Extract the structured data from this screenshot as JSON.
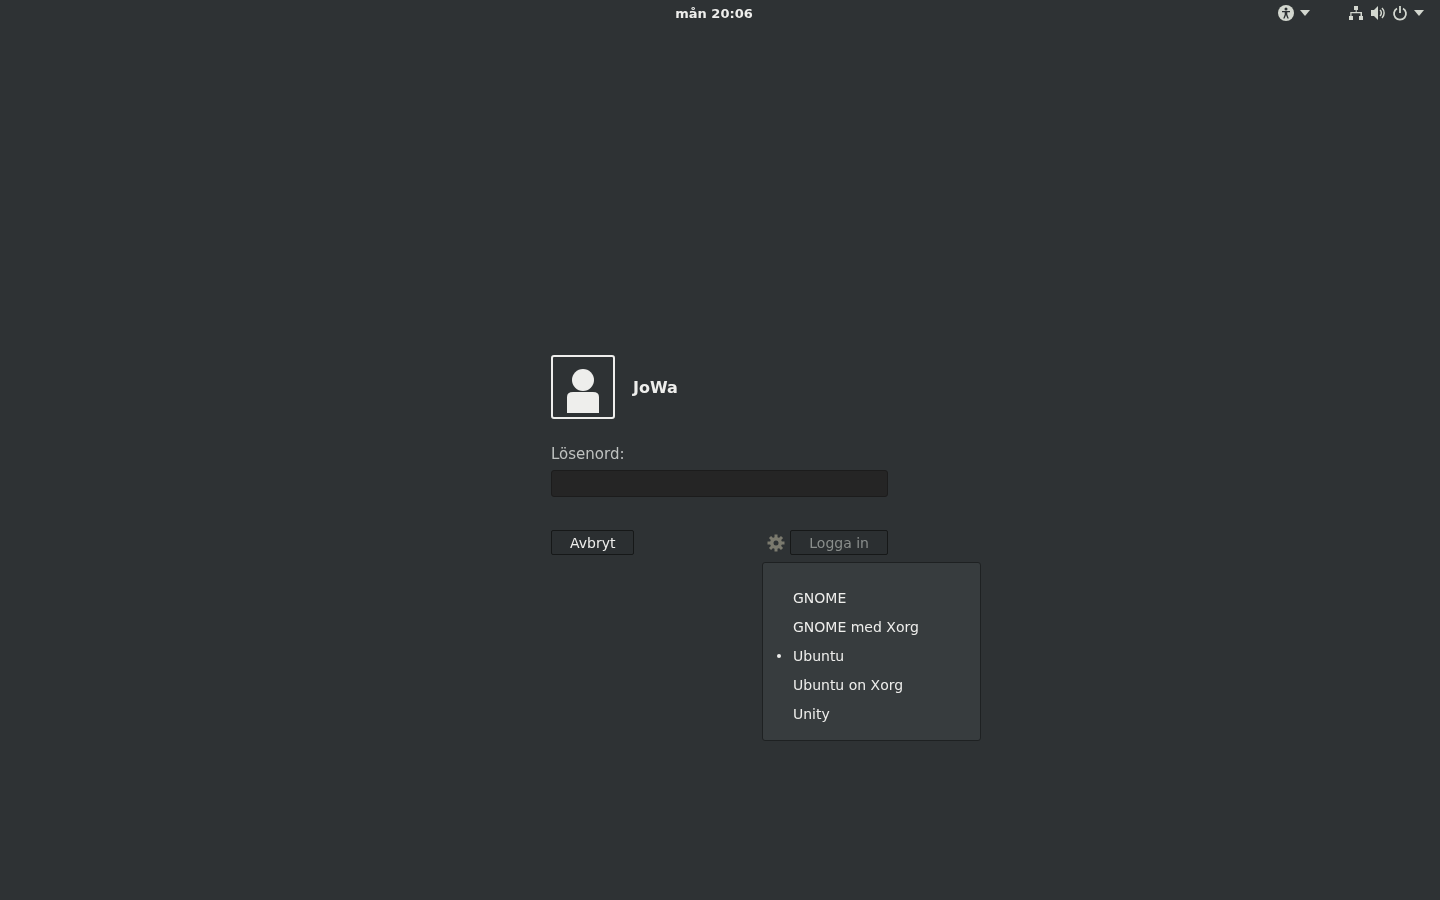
{
  "top_bar": {
    "clock": "mån 20:06"
  },
  "user": {
    "name": "JoWa"
  },
  "password": {
    "label": "Lösenord:"
  },
  "buttons": {
    "cancel": {
      "label": "Avbryt",
      "disabled": false
    },
    "login": {
      "label": "Logga in",
      "disabled": true
    }
  },
  "session_menu": {
    "open": true,
    "items": [
      {
        "label": "GNOME",
        "selected": false
      },
      {
        "label": "GNOME med Xorg",
        "selected": false
      },
      {
        "label": "Ubuntu",
        "selected": true
      },
      {
        "label": "Ubuntu on Xorg",
        "selected": false
      },
      {
        "label": "Unity",
        "selected": false
      }
    ]
  }
}
